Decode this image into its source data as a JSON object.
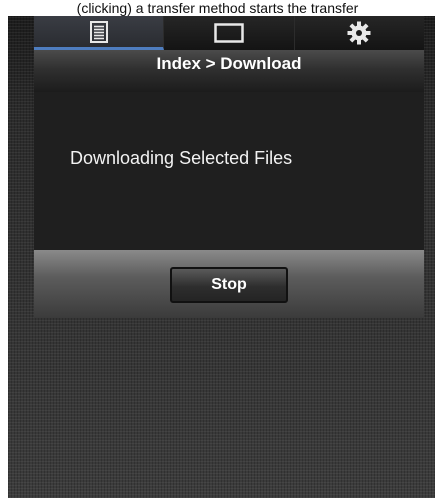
{
  "caption": "(clicking) a transfer method starts the transfer",
  "tabs": [
    {
      "icon": "document-list-icon",
      "active": true
    },
    {
      "icon": "screen-icon",
      "active": false
    },
    {
      "icon": "gear-icon",
      "active": false
    }
  ],
  "breadcrumb": "Index > Download",
  "status": "Downloading Selected Files",
  "stop_label": "Stop",
  "colors": {
    "active_tab_underline": "#4e7dbf",
    "panel_background": "#1f1f1f"
  }
}
